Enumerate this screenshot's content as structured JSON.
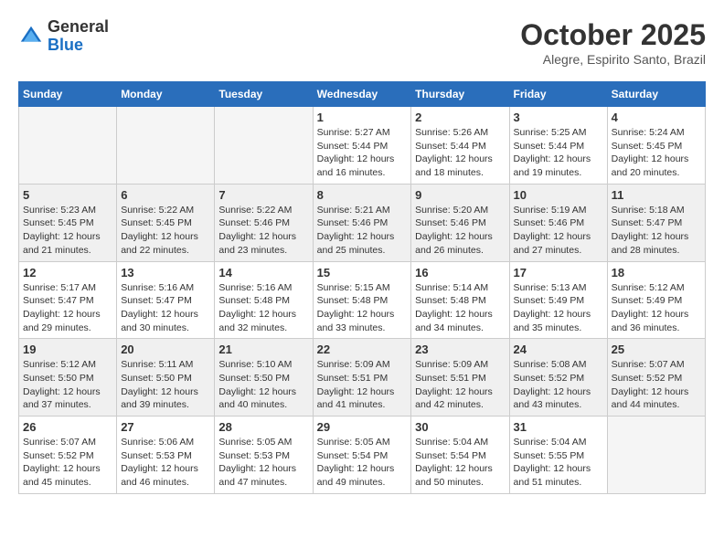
{
  "logo": {
    "general": "General",
    "blue": "Blue"
  },
  "title": {
    "month": "October 2025",
    "location": "Alegre, Espirito Santo, Brazil"
  },
  "weekdays": [
    "Sunday",
    "Monday",
    "Tuesday",
    "Wednesday",
    "Thursday",
    "Friday",
    "Saturday"
  ],
  "weeks": [
    [
      {
        "day": "",
        "info": ""
      },
      {
        "day": "",
        "info": ""
      },
      {
        "day": "",
        "info": ""
      },
      {
        "day": "1",
        "info": "Sunrise: 5:27 AM\nSunset: 5:44 PM\nDaylight: 12 hours\nand 16 minutes."
      },
      {
        "day": "2",
        "info": "Sunrise: 5:26 AM\nSunset: 5:44 PM\nDaylight: 12 hours\nand 18 minutes."
      },
      {
        "day": "3",
        "info": "Sunrise: 5:25 AM\nSunset: 5:44 PM\nDaylight: 12 hours\nand 19 minutes."
      },
      {
        "day": "4",
        "info": "Sunrise: 5:24 AM\nSunset: 5:45 PM\nDaylight: 12 hours\nand 20 minutes."
      }
    ],
    [
      {
        "day": "5",
        "info": "Sunrise: 5:23 AM\nSunset: 5:45 PM\nDaylight: 12 hours\nand 21 minutes."
      },
      {
        "day": "6",
        "info": "Sunrise: 5:22 AM\nSunset: 5:45 PM\nDaylight: 12 hours\nand 22 minutes."
      },
      {
        "day": "7",
        "info": "Sunrise: 5:22 AM\nSunset: 5:46 PM\nDaylight: 12 hours\nand 23 minutes."
      },
      {
        "day": "8",
        "info": "Sunrise: 5:21 AM\nSunset: 5:46 PM\nDaylight: 12 hours\nand 25 minutes."
      },
      {
        "day": "9",
        "info": "Sunrise: 5:20 AM\nSunset: 5:46 PM\nDaylight: 12 hours\nand 26 minutes."
      },
      {
        "day": "10",
        "info": "Sunrise: 5:19 AM\nSunset: 5:46 PM\nDaylight: 12 hours\nand 27 minutes."
      },
      {
        "day": "11",
        "info": "Sunrise: 5:18 AM\nSunset: 5:47 PM\nDaylight: 12 hours\nand 28 minutes."
      }
    ],
    [
      {
        "day": "12",
        "info": "Sunrise: 5:17 AM\nSunset: 5:47 PM\nDaylight: 12 hours\nand 29 minutes."
      },
      {
        "day": "13",
        "info": "Sunrise: 5:16 AM\nSunset: 5:47 PM\nDaylight: 12 hours\nand 30 minutes."
      },
      {
        "day": "14",
        "info": "Sunrise: 5:16 AM\nSunset: 5:48 PM\nDaylight: 12 hours\nand 32 minutes."
      },
      {
        "day": "15",
        "info": "Sunrise: 5:15 AM\nSunset: 5:48 PM\nDaylight: 12 hours\nand 33 minutes."
      },
      {
        "day": "16",
        "info": "Sunrise: 5:14 AM\nSunset: 5:48 PM\nDaylight: 12 hours\nand 34 minutes."
      },
      {
        "day": "17",
        "info": "Sunrise: 5:13 AM\nSunset: 5:49 PM\nDaylight: 12 hours\nand 35 minutes."
      },
      {
        "day": "18",
        "info": "Sunrise: 5:12 AM\nSunset: 5:49 PM\nDaylight: 12 hours\nand 36 minutes."
      }
    ],
    [
      {
        "day": "19",
        "info": "Sunrise: 5:12 AM\nSunset: 5:50 PM\nDaylight: 12 hours\nand 37 minutes."
      },
      {
        "day": "20",
        "info": "Sunrise: 5:11 AM\nSunset: 5:50 PM\nDaylight: 12 hours\nand 39 minutes."
      },
      {
        "day": "21",
        "info": "Sunrise: 5:10 AM\nSunset: 5:50 PM\nDaylight: 12 hours\nand 40 minutes."
      },
      {
        "day": "22",
        "info": "Sunrise: 5:09 AM\nSunset: 5:51 PM\nDaylight: 12 hours\nand 41 minutes."
      },
      {
        "day": "23",
        "info": "Sunrise: 5:09 AM\nSunset: 5:51 PM\nDaylight: 12 hours\nand 42 minutes."
      },
      {
        "day": "24",
        "info": "Sunrise: 5:08 AM\nSunset: 5:52 PM\nDaylight: 12 hours\nand 43 minutes."
      },
      {
        "day": "25",
        "info": "Sunrise: 5:07 AM\nSunset: 5:52 PM\nDaylight: 12 hours\nand 44 minutes."
      }
    ],
    [
      {
        "day": "26",
        "info": "Sunrise: 5:07 AM\nSunset: 5:52 PM\nDaylight: 12 hours\nand 45 minutes."
      },
      {
        "day": "27",
        "info": "Sunrise: 5:06 AM\nSunset: 5:53 PM\nDaylight: 12 hours\nand 46 minutes."
      },
      {
        "day": "28",
        "info": "Sunrise: 5:05 AM\nSunset: 5:53 PM\nDaylight: 12 hours\nand 47 minutes."
      },
      {
        "day": "29",
        "info": "Sunrise: 5:05 AM\nSunset: 5:54 PM\nDaylight: 12 hours\nand 49 minutes."
      },
      {
        "day": "30",
        "info": "Sunrise: 5:04 AM\nSunset: 5:54 PM\nDaylight: 12 hours\nand 50 minutes."
      },
      {
        "day": "31",
        "info": "Sunrise: 5:04 AM\nSunset: 5:55 PM\nDaylight: 12 hours\nand 51 minutes."
      },
      {
        "day": "",
        "info": ""
      }
    ]
  ]
}
